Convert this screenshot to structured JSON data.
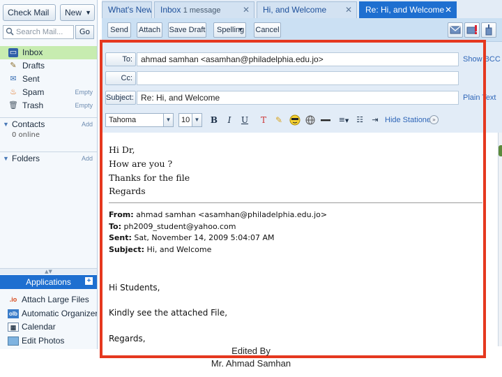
{
  "sidebar": {
    "check_mail": "Check Mail",
    "new": "New",
    "search_placeholder": "Search Mail...",
    "go": "Go",
    "folders": [
      {
        "label": "Inbox",
        "icon": "inbox-icon",
        "side": ""
      },
      {
        "label": "Drafts",
        "icon": "drafts-icon",
        "side": ""
      },
      {
        "label": "Sent",
        "icon": "sent-icon",
        "side": ""
      },
      {
        "label": "Spam",
        "icon": "spam-icon",
        "side": "Empty"
      },
      {
        "label": "Trash",
        "icon": "trash-icon",
        "side": "Empty"
      }
    ],
    "contacts": {
      "label": "Contacts",
      "action": "Add",
      "status": "0 online"
    },
    "folders_section": {
      "label": "Folders",
      "action": "Add"
    },
    "applications": {
      "title": "Applications",
      "items": [
        {
          "label": "Attach Large Files",
          "badge": ".io"
        },
        {
          "label": "Automatic Organizer",
          "badge": "olb"
        },
        {
          "label": "Calendar",
          "badge": ""
        },
        {
          "label": "Edit Photos",
          "badge": ""
        }
      ]
    }
  },
  "tabs": [
    {
      "label": "What's New",
      "sub": ""
    },
    {
      "label": "Inbox",
      "sub": "1 message"
    },
    {
      "label": "Hi, and Welcome",
      "sub": ""
    },
    {
      "label": "Re: Hi, and Welcome",
      "sub": ""
    }
  ],
  "toolbar": {
    "send": "Send",
    "attach": "Attach",
    "save_draft": "Save Draft",
    "spelling": "Spelling",
    "cancel": "Cancel"
  },
  "compose": {
    "to_label": "To:",
    "to_value": "ahmad samhan <asamhan@philadelphia.edu.jo>",
    "show_bcc": "Show BCC",
    "cc_label": "Cc:",
    "cc_value": "",
    "subject_label": "Subject:",
    "subject_value": "Re: Hi, and Welcome",
    "plain_text": "Plain Text",
    "font": "Tahoma",
    "font_size": "10",
    "hide_stationery": "Hide Stationery"
  },
  "body": {
    "reply_lines": [
      "Hi Dr,",
      "How are you ?",
      "Thanks for the file",
      "Regards"
    ],
    "quoted": {
      "from_label": "From:",
      "from_value": "ahmad samhan <asamhan@philadelphia.edu.jo>",
      "to_label": "To:",
      "to_value": "ph2009_student@yahoo.com",
      "sent_label": "Sent:",
      "sent_value": "Sat, November 14, 2009 5:04:07 AM",
      "subject_label": "Subject:",
      "subject_value": "Hi, and Welcome"
    },
    "original_lines": [
      "Hi Students,",
      "Kindly see the attached File,",
      "Regards,"
    ]
  },
  "caption": {
    "line1": "Edited By",
    "line2": "Mr. Ahmad Samhan"
  },
  "colors": {
    "accent": "#1e6fd0",
    "annotation_frame": "#e5381f",
    "active_folder": "#c7ecb0"
  }
}
